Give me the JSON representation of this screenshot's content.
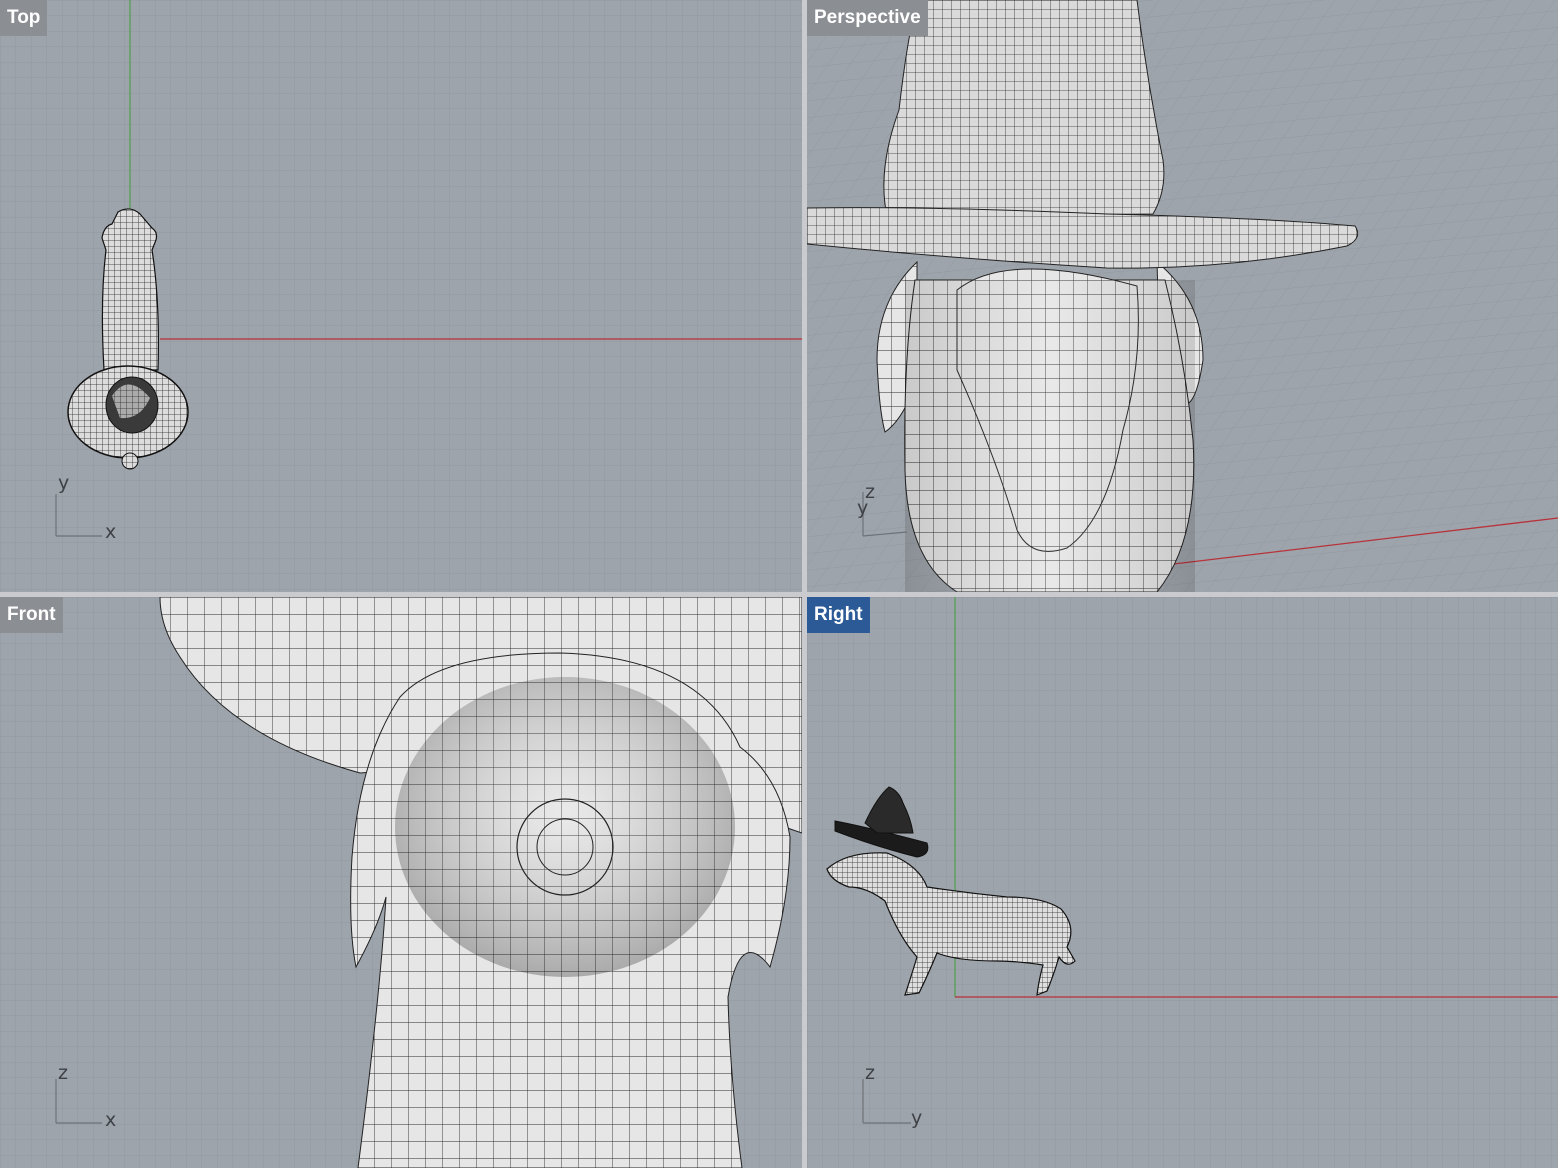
{
  "viewports": {
    "top": {
      "label": "Top",
      "axis_h": "x",
      "axis_v": "y"
    },
    "perspective": {
      "label": "Perspective",
      "axis_a": "z",
      "axis_b": "y"
    },
    "front": {
      "label": "Front",
      "axis_h": "x",
      "axis_v": "z"
    },
    "right": {
      "label": "Right",
      "axis_h": "y",
      "axis_v": "z"
    }
  },
  "active_viewport": "Right",
  "colors": {
    "viewport_bg": "#9ea4ab",
    "grid_minor": "#9098a0",
    "grid_major": "#858d96",
    "x_axis": "#b8323a",
    "y_axis": "#4e9e4e",
    "label_bg": "#8b8f94",
    "active_label_bg": "#2b5a97",
    "mesh_fill": "#e4e4e4",
    "mesh_wire": "#2a2a2a",
    "hat_dark": "#1a1a1a"
  }
}
